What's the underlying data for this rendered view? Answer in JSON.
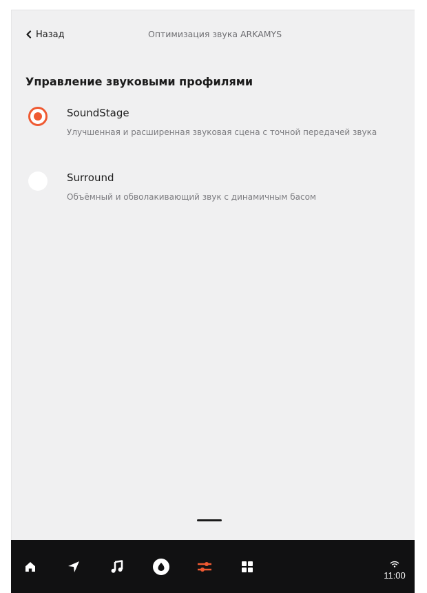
{
  "header": {
    "back_label": "Назад",
    "title": "Оптимизация звука ARKAMYS"
  },
  "section": {
    "title": "Управление звуковыми профилями"
  },
  "options": [
    {
      "label": "SoundStage",
      "description": "Улучшенная и расширенная звуковая сцена с точной передачей звука",
      "selected": true
    },
    {
      "label": "Surround",
      "description": "Объёмный и обволакивающий звук с динамичным басом",
      "selected": false
    }
  ],
  "navbar": {
    "items": [
      {
        "icon": "home-icon",
        "active": false
      },
      {
        "icon": "navigation-arrow-icon",
        "active": false
      },
      {
        "icon": "music-note-icon",
        "active": false
      },
      {
        "icon": "alice-assistant-icon",
        "active": false
      },
      {
        "icon": "settings-sliders-icon",
        "active": true
      },
      {
        "icon": "apps-grid-icon",
        "active": false
      }
    ],
    "time": "11:00",
    "status_icon": "wifi-icon"
  },
  "colors": {
    "accent": "#ef5a32",
    "background": "#f0f0f1",
    "navbar": "#111112",
    "icon": "#ffffff"
  }
}
